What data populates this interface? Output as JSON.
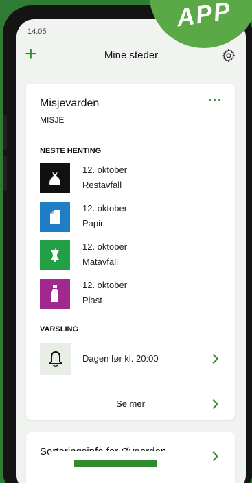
{
  "badge": {
    "label": "APP"
  },
  "status_bar": {
    "time": "14:05"
  },
  "header": {
    "title": "Mine steder"
  },
  "location": {
    "name": "Misjevarden",
    "subtitle": "MISJE",
    "menu_label": "···"
  },
  "pickups": {
    "heading": "NESTE HENTING",
    "items": [
      {
        "date": "12. oktober",
        "type": "Restavfall",
        "color": "#111111",
        "icon": "trash-bag-icon"
      },
      {
        "date": "12. oktober",
        "type": "Papir",
        "color": "#1f7ec4",
        "icon": "paper-icon"
      },
      {
        "date": "12. oktober",
        "type": "Matavfall",
        "color": "#23a045",
        "icon": "apple-core-icon"
      },
      {
        "date": "12. oktober",
        "type": "Plast",
        "color": "#a0288f",
        "icon": "plastic-bottle-icon"
      }
    ]
  },
  "notification": {
    "heading": "VARSLING",
    "text": "Dagen før kl. 20:00"
  },
  "see_more": {
    "label": "Se mer"
  },
  "info_card": {
    "title": "Sorteringsinfo for Øygarden"
  },
  "colors": {
    "accent": "#2e8b2e",
    "background": "#3a8f3f"
  }
}
